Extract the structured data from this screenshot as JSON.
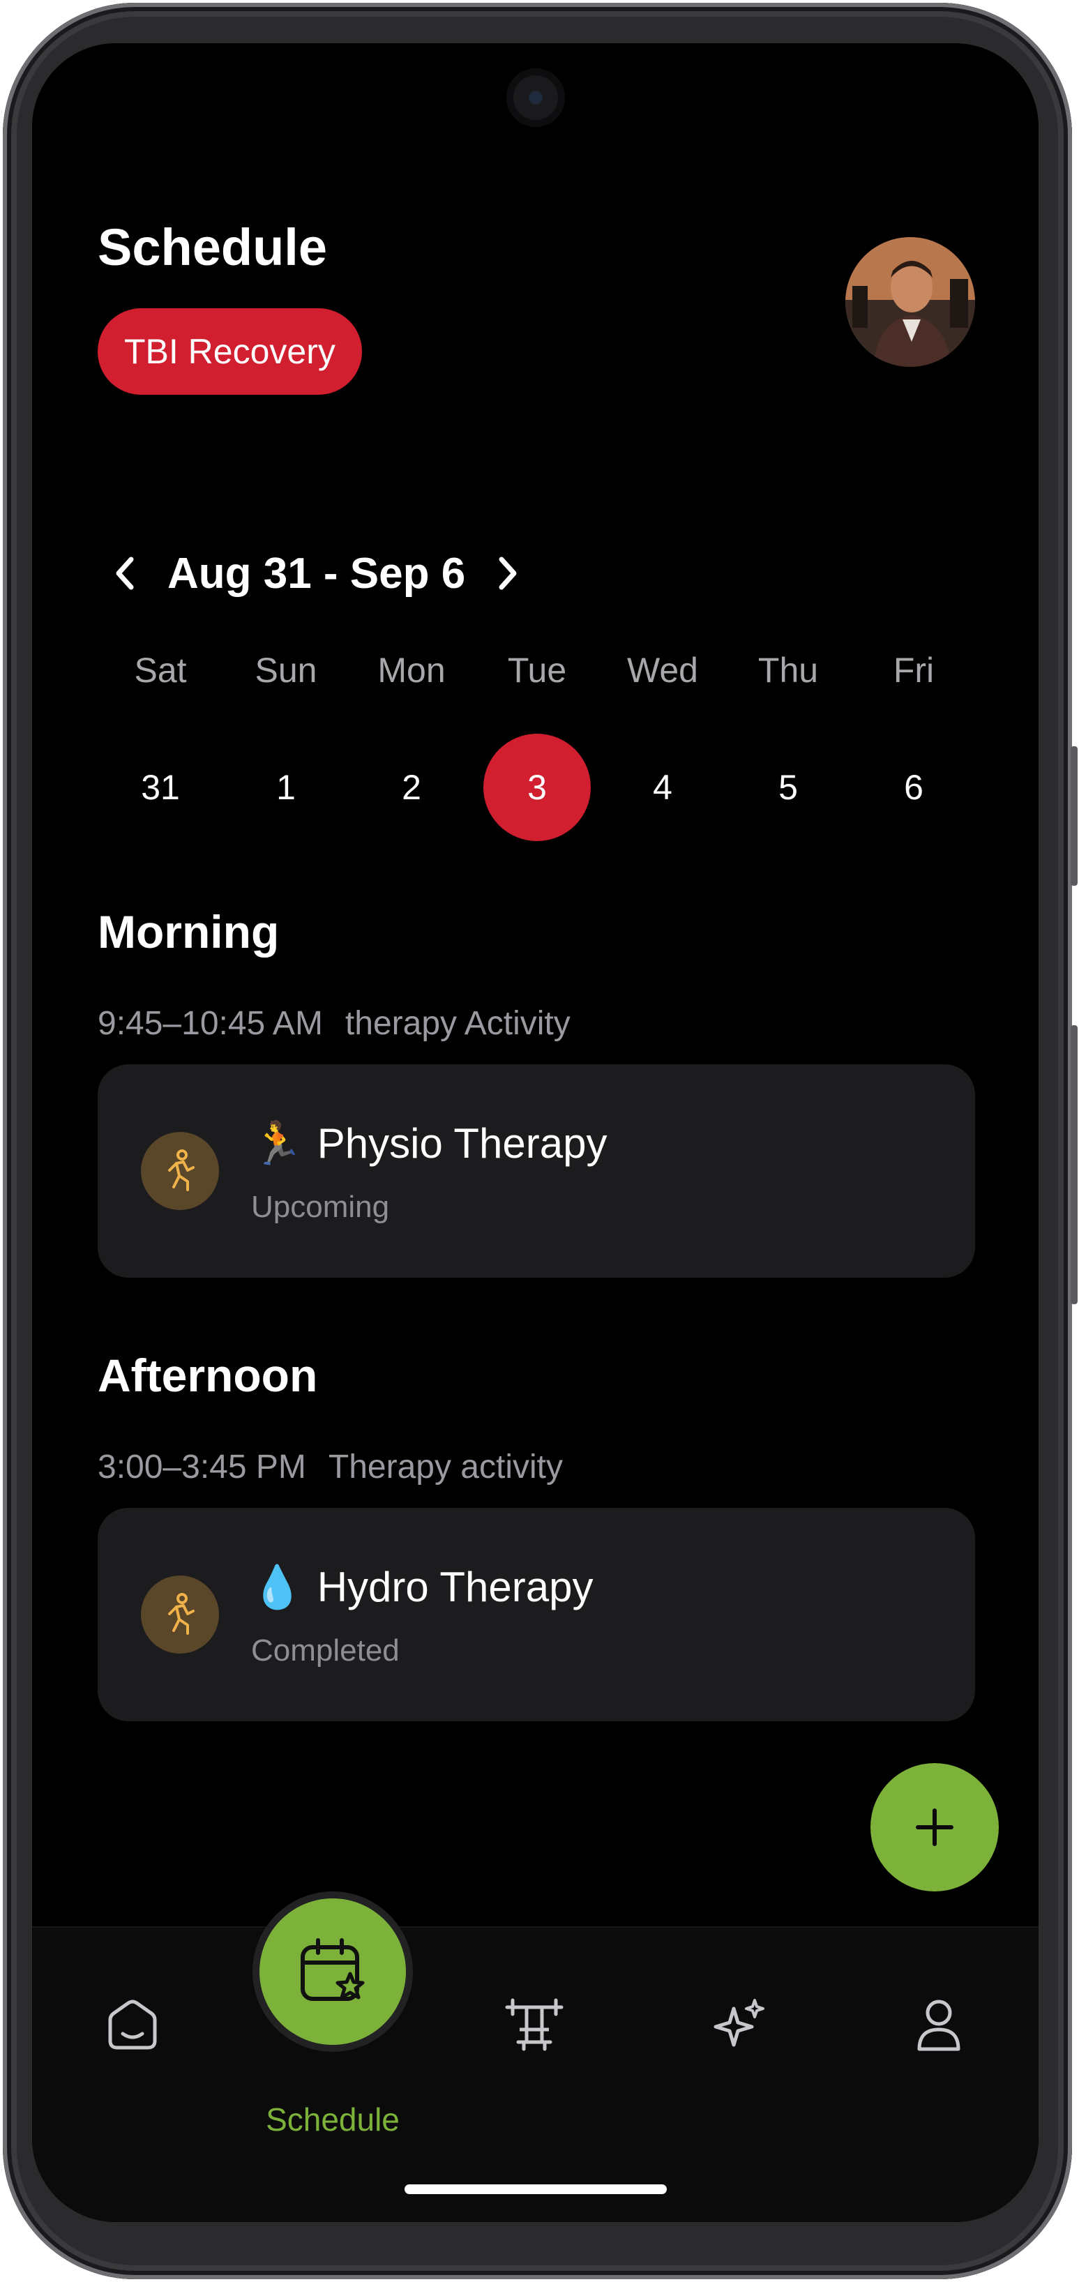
{
  "header": {
    "title": "Schedule",
    "program_pill": "TBI Recovery",
    "avatar_icon": "user-avatar-photo"
  },
  "week": {
    "range_label": "Aug 31 - Sep 6",
    "days": [
      {
        "name": "Sat",
        "date": "31"
      },
      {
        "name": "Sun",
        "date": "1"
      },
      {
        "name": "Mon",
        "date": "2"
      },
      {
        "name": "Tue",
        "date": "3"
      },
      {
        "name": "Wed",
        "date": "4"
      },
      {
        "name": "Thu",
        "date": "5"
      },
      {
        "name": "Fri",
        "date": "6"
      }
    ],
    "selected_date": "3"
  },
  "sections": [
    {
      "title": "Morning",
      "time": "9:45–10:45 AM",
      "category": "therapy Activity",
      "activity": {
        "emoji": "🏃",
        "name": "Physio Therapy",
        "status": "Upcoming",
        "icon": "exercise-figure-icon"
      }
    },
    {
      "title": "Afternoon",
      "time": "3:00–3:45 PM",
      "category": "Therapy activity",
      "activity": {
        "emoji": "💧",
        "name": "Hydro Therapy",
        "status": "Completed",
        "icon": "exercise-figure-icon"
      }
    }
  ],
  "fab": {
    "icon": "plus-icon"
  },
  "bottom_nav": {
    "items": [
      {
        "icon": "home-icon"
      },
      {
        "icon": "calendar-star-icon",
        "label": "Schedule",
        "active": true
      },
      {
        "icon": "exercise-equipment-icon"
      },
      {
        "icon": "sparkle-icon"
      },
      {
        "icon": "profile-icon"
      }
    ]
  },
  "colors": {
    "accent_red": "#d11f2f",
    "accent_green": "#7db23a",
    "background": "#000000",
    "card": "#1c1c1e",
    "muted_text": "#9a9aa0"
  }
}
